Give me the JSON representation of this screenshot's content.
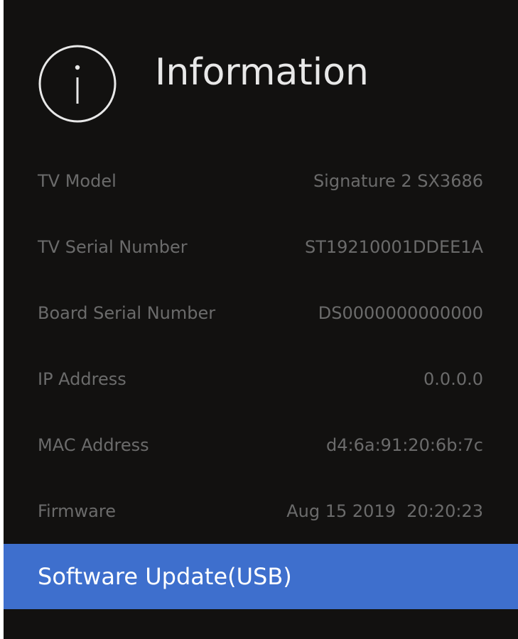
{
  "header": {
    "title": "Information",
    "icon": "info-icon"
  },
  "rows": [
    {
      "label": "TV Model",
      "value": "Signature 2 SX3686"
    },
    {
      "label": "TV Serial Number",
      "value": "ST19210001DDEE1A"
    },
    {
      "label": "Board Serial Number",
      "value": "DS0000000000000"
    },
    {
      "label": "IP Address",
      "value": "0.0.0.0"
    },
    {
      "label": "MAC Address",
      "value": "d4:6a:91:20:6b:7c"
    },
    {
      "label": "Firmware",
      "value": "Aug 15 2019  20:20:23"
    }
  ],
  "menu": {
    "software_update_label": "Software Update(USB)"
  },
  "colors": {
    "background": "#121110",
    "highlight": "#3e6fcd",
    "title_text": "#e8e8e8",
    "dim_text": "#6b6b6b"
  }
}
